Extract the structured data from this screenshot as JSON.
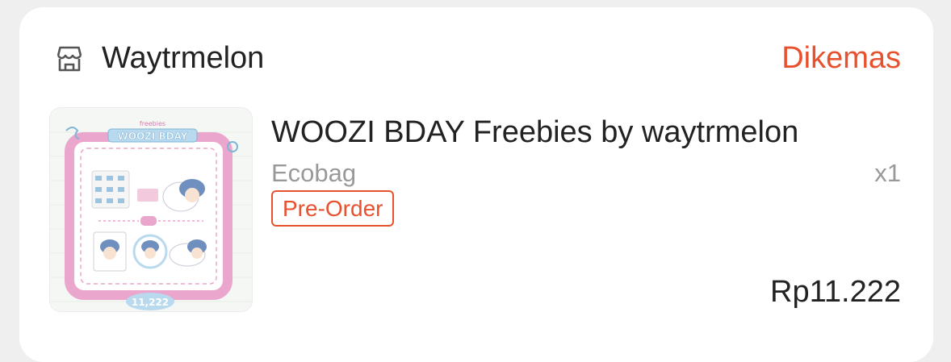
{
  "shop": {
    "name": "Waytrmelon",
    "icon": "store-icon"
  },
  "order": {
    "status": "Dikemas"
  },
  "product": {
    "name": "WOOZI BDAY Freebies by waytrmelon",
    "variant": "Ecobag",
    "quantity": "x1",
    "badge": "Pre-Order",
    "price": "Rp11.222",
    "image_text": {
      "tag": "freebies",
      "title": "WOOZI BDAY",
      "number": "11,222"
    }
  },
  "colors": {
    "accent": "#e8512e",
    "frame": "#eaa6cc",
    "blue": "#b9d9ee"
  }
}
